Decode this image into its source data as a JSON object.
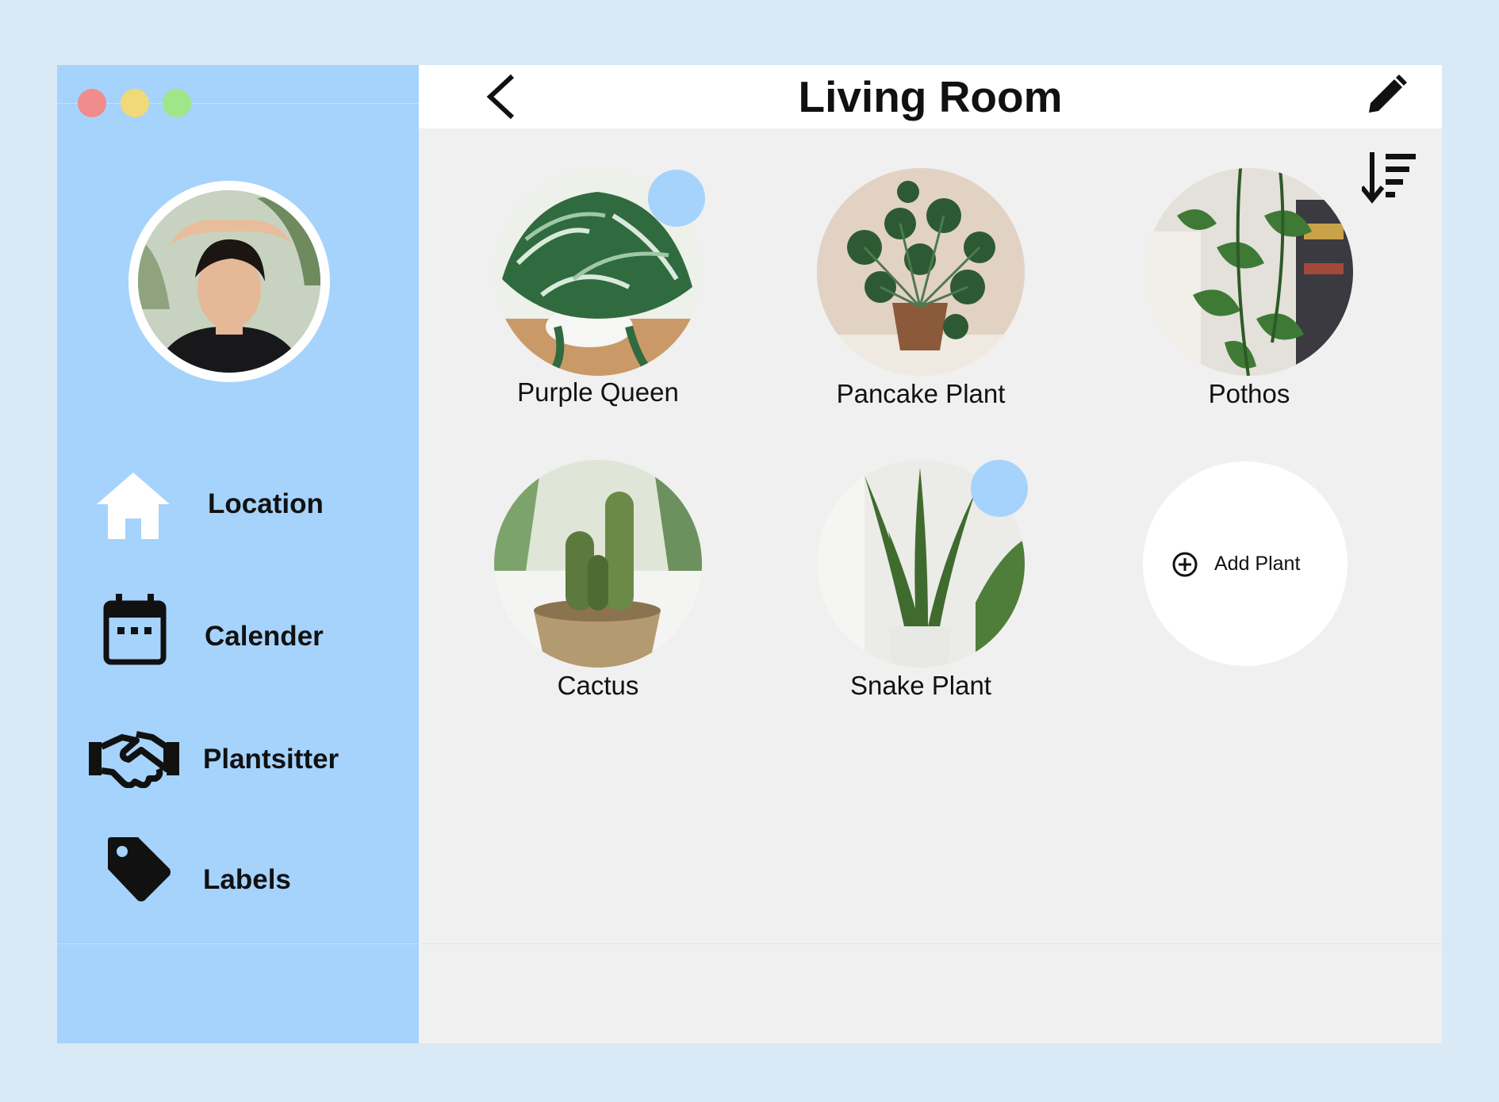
{
  "window": {
    "traffic_lights": {
      "close_color": "#f28b8b",
      "minimize_color": "#f0d978",
      "maximize_color": "#9ee688"
    }
  },
  "sidebar": {
    "background": "#a5d3fb",
    "profile": {
      "icon": "user-avatar"
    },
    "nav_items": [
      {
        "label": "Location",
        "icon": "home-icon"
      },
      {
        "label": "Calender",
        "icon": "calendar-icon"
      },
      {
        "label": "Plantsitter",
        "icon": "handshake-icon"
      },
      {
        "label": "Labels",
        "icon": "tag-icon"
      }
    ]
  },
  "header": {
    "title": "Living Room",
    "back_icon": "chevron-left-icon",
    "edit_icon": "pencil-icon",
    "sort_icon": "sort-descending-icon"
  },
  "plants": [
    {
      "name": "Purple Queen",
      "has_badge": true
    },
    {
      "name": "Pancake Plant",
      "has_badge": false
    },
    {
      "name": "Pothos",
      "has_badge": false
    },
    {
      "name": "Cactus",
      "has_badge": false
    },
    {
      "name": "Snake Plant",
      "has_badge": true
    }
  ],
  "add_plant": {
    "label": "Add Plant",
    "icon": "plus-circle-icon"
  }
}
